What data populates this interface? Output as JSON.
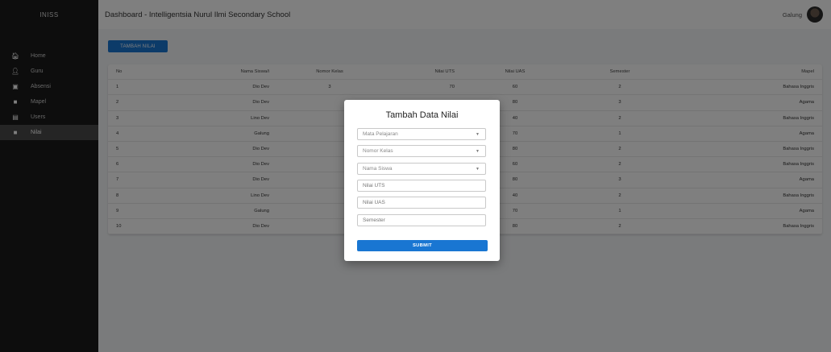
{
  "brand": "INISS",
  "sidebar": {
    "items": [
      {
        "label": "Home",
        "icon": "home-icon",
        "glyph": "🏠︎"
      },
      {
        "label": "Guru",
        "icon": "person-icon",
        "glyph": "👤︎"
      },
      {
        "label": "Absensi",
        "icon": "calendar-icon",
        "glyph": "▣"
      },
      {
        "label": "Mapel",
        "icon": "book-icon",
        "glyph": "■"
      },
      {
        "label": "Users",
        "icon": "id-card-icon",
        "glyph": "▤"
      },
      {
        "label": "Nilai",
        "icon": "grade-icon",
        "glyph": "■",
        "active": true
      }
    ]
  },
  "header": {
    "title": "Dashboard - Intelligentsia Nurul Ilmi Secondary School",
    "user": "Galung"
  },
  "toolbar": {
    "add_label": "TAMBAH NILAI"
  },
  "table": {
    "headers": [
      "No",
      "Nama Siswa/i",
      "Nomor Kelas",
      "Nilai UTS",
      "Nilai UAS",
      "Semester",
      "Mapel"
    ],
    "rows": [
      [
        "1",
        "Dio Dev",
        "3",
        "70",
        "60",
        "2",
        "Bahasa Inggris"
      ],
      [
        "2",
        "Dio Dev",
        "",
        "",
        "80",
        "3",
        "Agama"
      ],
      [
        "3",
        "Lino Dev",
        "",
        "",
        "40",
        "2",
        "Bahasa Inggris"
      ],
      [
        "4",
        "Galung",
        "",
        "",
        "70",
        "1",
        "Agama"
      ],
      [
        "5",
        "Dio Dev",
        "",
        "",
        "80",
        "2",
        "Bahasa Inggris"
      ],
      [
        "6",
        "Dio Dev",
        "",
        "",
        "60",
        "2",
        "Bahasa Inggris"
      ],
      [
        "7",
        "Dio Dev",
        "",
        "",
        "80",
        "3",
        "Agama"
      ],
      [
        "8",
        "Lino Dev",
        "",
        "",
        "40",
        "2",
        "Bahasa Inggris"
      ],
      [
        "9",
        "Galung",
        "",
        "",
        "70",
        "1",
        "Agama"
      ],
      [
        "10",
        "Dio Dev",
        "",
        "",
        "80",
        "2",
        "Bahasa Inggris"
      ]
    ]
  },
  "modal": {
    "title": "Tambah Data Nilai",
    "fields": {
      "mapel": "Mata Pelajaran",
      "kelas": "Nomor Kelas",
      "siswa": "Nama Siswa",
      "uts": "Nilai UTS",
      "uas": "Nilai UAS",
      "semester": "Semester"
    },
    "submit": "SUBMIT"
  },
  "colors": {
    "primary": "#1976d2",
    "sidebar": "#1b1b1b"
  }
}
